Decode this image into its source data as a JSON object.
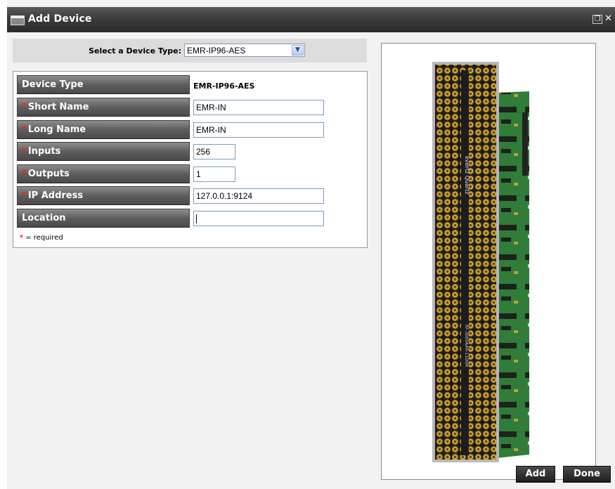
{
  "window": {
    "title": "Add Device",
    "restore_glyph": "❐",
    "close_glyph": "✕"
  },
  "device_type_selector": {
    "label": "Select a Device Type:",
    "selected": "EMR-IP96-AES",
    "arrow_glyph": "▼"
  },
  "form": {
    "device_type": {
      "label": "Device Type",
      "value": "EMR-IP96-AES"
    },
    "short_name": {
      "label": "Short Name",
      "value": "EMR-IN",
      "required": true
    },
    "long_name": {
      "label": "Long Name",
      "value": "EMR-IN",
      "required": true
    },
    "inputs": {
      "label": "Inputs",
      "value": "256",
      "required": true
    },
    "outputs": {
      "label": "Outputs",
      "value": "1",
      "required": true
    },
    "ip_address": {
      "label": "IP Address",
      "value": "127.0.0.1:9124",
      "required": true
    },
    "location": {
      "label": "Location",
      "value": ""
    },
    "required_star": "*",
    "required_note": "= required"
  },
  "device_image": {
    "brand_text": "evertz Quartz",
    "model_text": "RF-3000AAR-1100M",
    "colors": {
      "panel": "#1c1c1c",
      "connector": "#c9a23a",
      "pcb": "#2f7d38"
    }
  },
  "buttons": {
    "add": "Add",
    "done": "Done"
  },
  "colors": {
    "titlebar": "#3c3c3c",
    "label_bar": "#5e5e5e",
    "required_star": "#ff2020"
  }
}
